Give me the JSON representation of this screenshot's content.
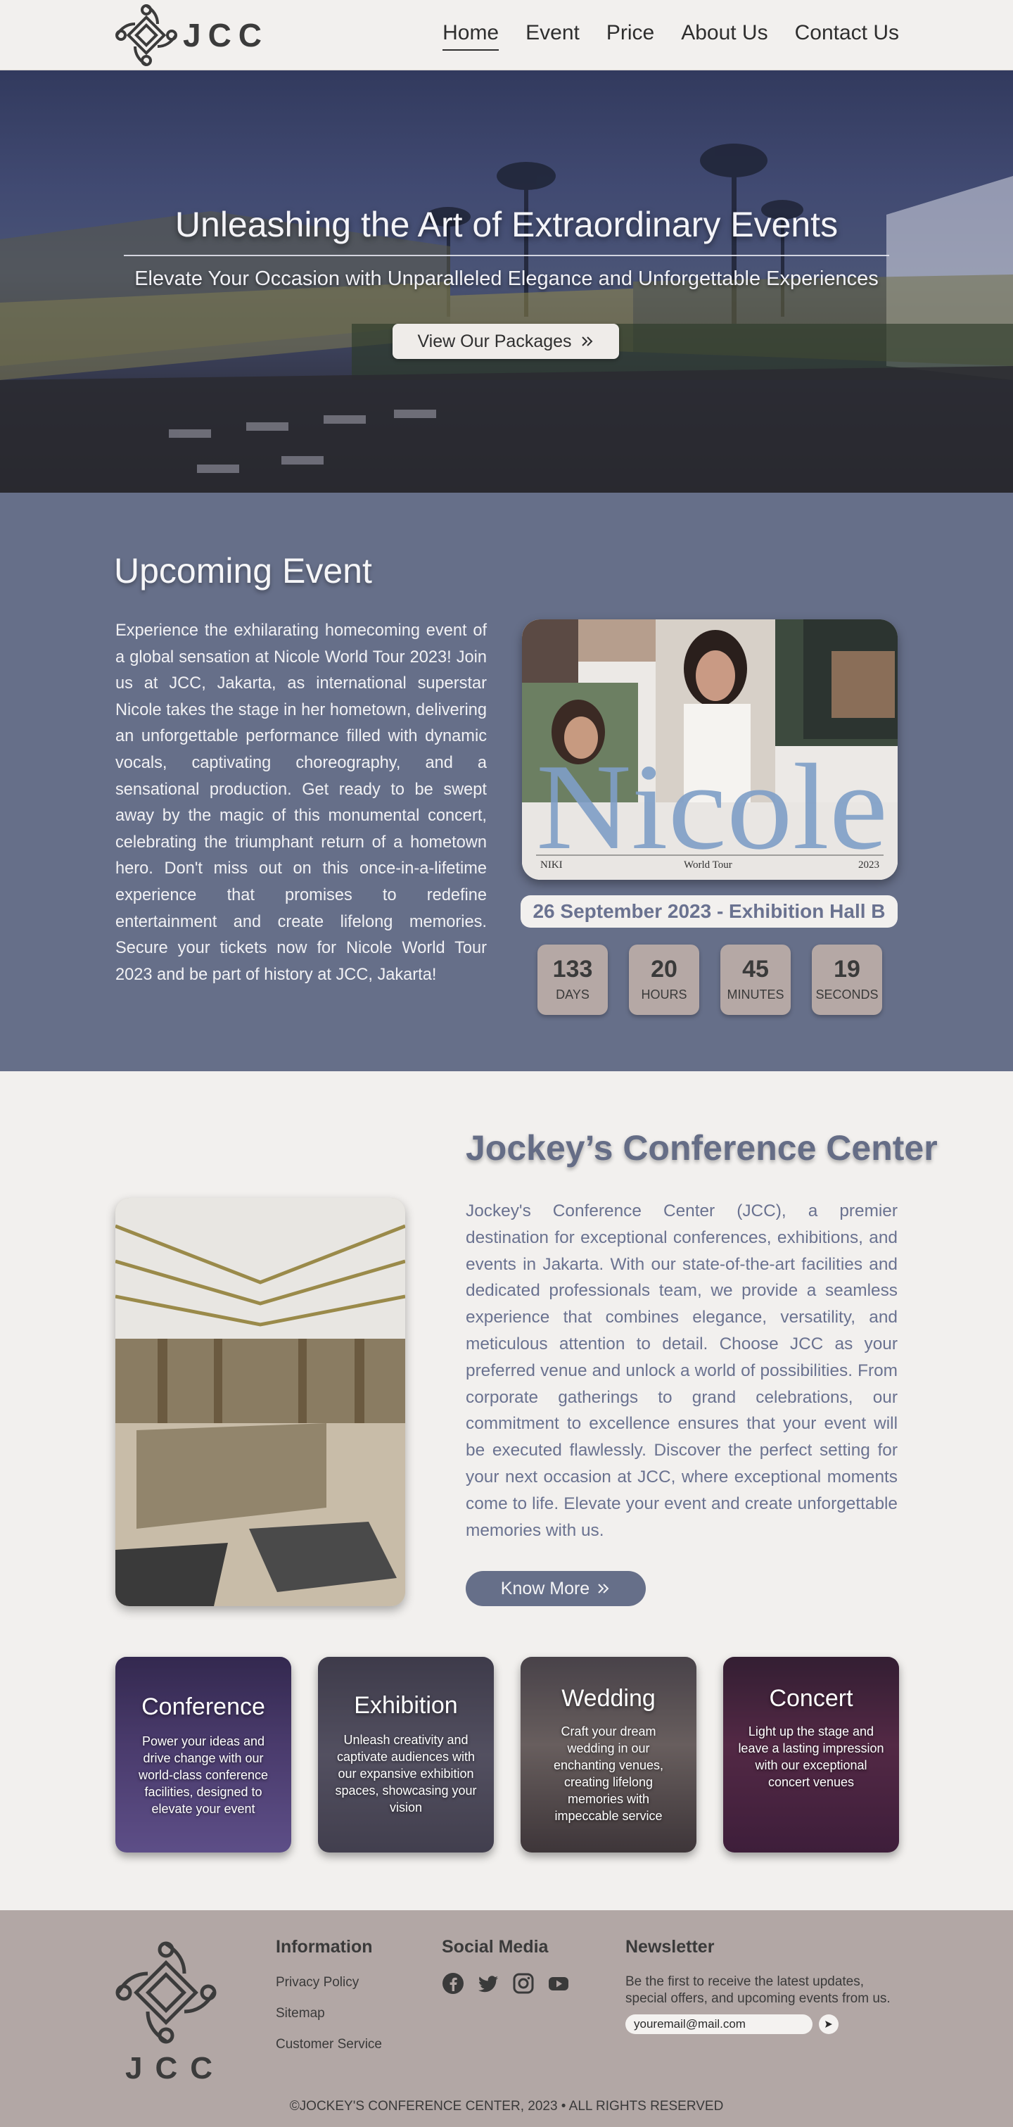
{
  "nav": {
    "logo_text": "JCC",
    "items": [
      {
        "label": "Home",
        "active": true
      },
      {
        "label": "Event",
        "active": false
      },
      {
        "label": "Price",
        "active": false
      },
      {
        "label": "About Us",
        "active": false
      },
      {
        "label": "Contact Us",
        "active": false
      }
    ]
  },
  "hero": {
    "title": "Unleashing the Art of Extraordinary Events",
    "subtitle": "Elevate Your Occasion with Unparalleled Elegance and Unforgettable Experiences",
    "button_label": "View Our Packages",
    "button_icon": "double-chevron-right-icon"
  },
  "upcoming": {
    "title": "Upcoming Event",
    "description": "Experience the exhilarating homecoming event of a global sensation at Nicole World Tour 2023! Join us at JCC, Jakarta, as international superstar Nicole takes the stage in her hometown, delivering an unforgettable performance filled with dynamic vocals, captivating choreography, and a sensational production. Get ready to be swept away by the magic of this monumental concert, celebrating the triumphant return of a hometown hero. Don't miss out on this once-in-a-lifetime experience that promises to redefine entertainment and create lifelong memories. Secure your tickets now for Nicole World Tour 2023 and be part of history at JCC, Jakarta!",
    "poster": {
      "name": "Nicole",
      "left_label": "NIKI",
      "center_label": "World Tour",
      "right_label": "2023"
    },
    "date": "26 September 2023 - Exhibition Hall B",
    "countdown": [
      {
        "value": "133",
        "label": "DAYS"
      },
      {
        "value": "20",
        "label": "HOURS"
      },
      {
        "value": "45",
        "label": "MINUTES"
      },
      {
        "value": "19",
        "label": "SECONDS"
      }
    ]
  },
  "about": {
    "title": "Jockey’s Conference Center",
    "description": "Jockey's Conference Center (JCC), a premier destination for exceptional conferences, exhibitions, and events in Jakarta. With our state-of-the-art facilities and dedicated professionals team, we provide a seamless experience that combines elegance, versatility, and meticulous attention to detail. Choose JCC as your preferred venue and unlock a world of possibilities. From corporate gatherings to grand celebrations, our commitment to excellence ensures that your event will be executed flawlessly. Discover the perfect setting for your next occasion at JCC, where exceptional moments come to life. Elevate your event and create unforgettable memories with us.",
    "button_label": "Know More"
  },
  "services": [
    {
      "title": "Conference",
      "text": "Power your ideas and drive change with our world-class conference facilities, designed to elevate your event"
    },
    {
      "title": "Exhibition",
      "text": "Unleash creativity and captivate audiences with our expansive exhibition spaces, showcasing your vision"
    },
    {
      "title": "Wedding",
      "text": "Craft your dream wedding in our enchanting venues, creating lifelong memories with impeccable service"
    },
    {
      "title": "Concert",
      "text": "Light up the stage and leave a lasting impression with our exceptional concert venues"
    }
  ],
  "footer": {
    "logo_text": "JCC",
    "information": {
      "heading": "Information",
      "links": [
        "Privacy Policy",
        "Sitemap",
        "Customer Service"
      ]
    },
    "social": {
      "heading": "Social Media",
      "icons": [
        "facebook-icon",
        "twitter-icon",
        "instagram-icon",
        "youtube-icon"
      ]
    },
    "newsletter": {
      "heading": "Newsletter",
      "text": "Be the first to receive the latest updates, special offers, and upcoming events from us.",
      "input_value": "youremail@mail.com"
    },
    "copyright": "©JOCKEY'S CONFERENCE CENTER, 2023 • ALL RIGHTS RESERVED"
  },
  "colors": {
    "slate": "#666f89",
    "cream": "#f2f0ee",
    "taupe": "#b2a7a5",
    "countdown_box": "#b5a8a5"
  }
}
